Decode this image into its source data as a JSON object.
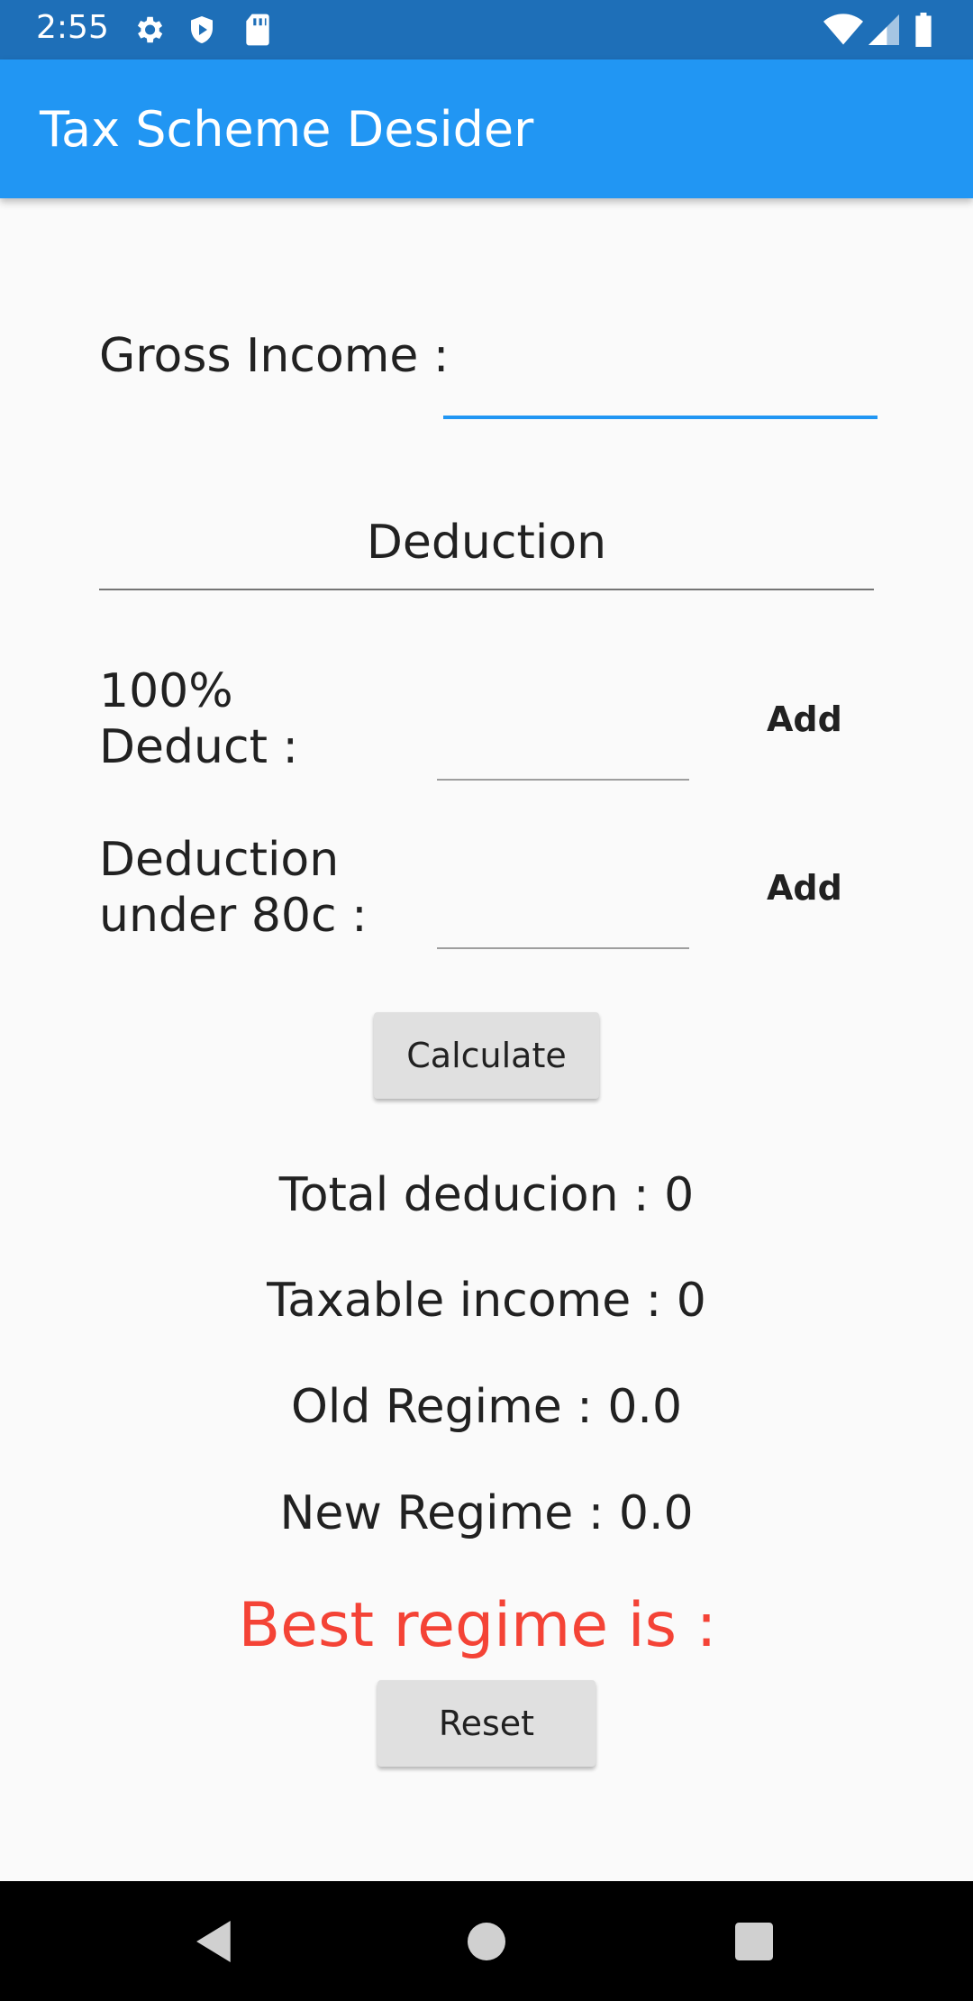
{
  "status_bar": {
    "time": "2:55",
    "icons": [
      "gear-icon",
      "shield-icon",
      "sd-card-icon",
      "wifi-icon",
      "signal-icon",
      "battery-icon"
    ]
  },
  "app_bar": {
    "title": "Tax Scheme Desider",
    "color": "#2196f3"
  },
  "form": {
    "gross_income_label": "Gross Income :",
    "gross_income_value": "",
    "deduction_heading": "Deduction",
    "deduct100_label_line1": "100%",
    "deduct100_label_line2": "Deduct :",
    "deduct100_value": "",
    "deduct100_add": "Add",
    "deduct80c_label_line1": "Deduction",
    "deduct80c_label_line2": "under 80c :",
    "deduct80c_value": "",
    "deduct80c_add": "Add",
    "calculate_label": "Calculate"
  },
  "results": {
    "total_deduction": "Total deducion : 0",
    "taxable_income": "Taxable income : 0",
    "old_regime": "Old Regime : 0.0",
    "new_regime": "New Regime : 0.0",
    "best_regime": "Best regime is :",
    "best_regime_color": "#f44336"
  },
  "reset_label": "Reset",
  "nav": {
    "icons": [
      "back-icon",
      "home-icon",
      "recents-icon"
    ]
  }
}
